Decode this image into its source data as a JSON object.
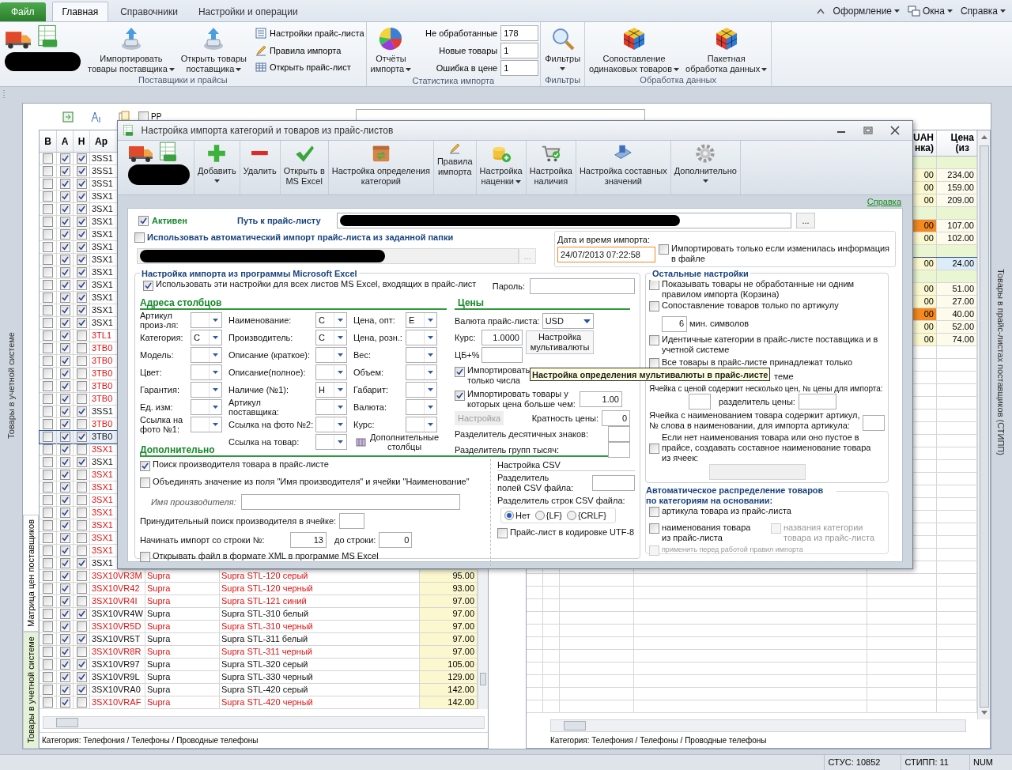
{
  "ribbon": {
    "tabs": [
      {
        "label": "Файл",
        "kind": "file",
        "selected": false
      },
      {
        "label": "Главная",
        "kind": "tab",
        "selected": true
      },
      {
        "label": "Справочники",
        "kind": "tab",
        "selected": false
      },
      {
        "label": "Настройки и операции",
        "kind": "tab",
        "selected": false
      }
    ],
    "right_menus": [
      {
        "label": "Оформление",
        "kind": "style"
      },
      {
        "label": "Окна",
        "kind": "windows"
      },
      {
        "label": "Справка",
        "kind": "plain"
      }
    ],
    "groups": [
      {
        "title": "Поставщики и прайсы",
        "buttons": [
          {
            "kind": "supplier"
          },
          {
            "kind": "import",
            "lines": [
              "Импортировать",
              "товары поставщика"
            ],
            "dropdown": true
          },
          {
            "kind": "open",
            "lines": [
              "Открыть товары",
              "поставщика"
            ],
            "dropdown": true
          }
        ],
        "small": [
          {
            "kind": "settings",
            "label": "Настройки прайс-листа"
          },
          {
            "kind": "rules",
            "label": "Правила импорта"
          },
          {
            "kind": "table",
            "label": "Открыть прайс-лист"
          }
        ]
      },
      {
        "title": "Статистика импорта",
        "buttons": [
          {
            "kind": "reports",
            "lines": [
              "Отчёты",
              "импорта"
            ],
            "dropdown": true
          }
        ],
        "stats": [
          {
            "label": "Не обработанные",
            "value": "178"
          },
          {
            "label": "Новые товары",
            "value": "1"
          },
          {
            "label": "Ошибка в цене",
            "value": "1"
          }
        ]
      },
      {
        "title": "Фильтры",
        "buttons": [
          {
            "kind": "filter",
            "lines": [
              "Фильтры"
            ],
            "dropdown": true
          }
        ]
      },
      {
        "title": "Обработка данных",
        "buttons": [
          {
            "kind": "match",
            "lines": [
              "Сопоставление",
              "одинаковых товаров"
            ],
            "dropdown": true
          },
          {
            "kind": "batch",
            "lines": [
              "Пакетная",
              "обработка данных"
            ],
            "dropdown": true
          }
        ]
      }
    ]
  },
  "background": {
    "pp": {
      "label": "PP",
      "checked": false
    },
    "left_tabs": [
      {
        "label": "Матрица цен поставщиков",
        "selected": true
      },
      {
        "label": "Товары в учетной системе",
        "selected": false
      }
    ],
    "upper_tab": "Товары в учетной системе",
    "right_tab": "Товары в прайс-листах поставщиков (СТИПП)",
    "left_table": {
      "columns": [
        "В",
        "А",
        "Н",
        "Ар"
      ],
      "rows": [
        {
          "article": "3SS1",
          "col_b": false,
          "col_a": true,
          "col_h": true,
          "highlighted": false,
          "selected": false
        },
        {
          "article": "3SS1",
          "col_b": false,
          "col_a": true,
          "col_h": true,
          "highlighted": false,
          "selected": false
        },
        {
          "article": "3SS1",
          "col_b": false,
          "col_a": true,
          "col_h": true,
          "highlighted": false,
          "selected": false
        },
        {
          "article": "3SX1",
          "col_b": false,
          "col_a": true,
          "col_h": true,
          "highlighted": false,
          "selected": false
        },
        {
          "article": "3SX1",
          "col_b": false,
          "col_a": true,
          "col_h": true,
          "highlighted": false,
          "selected": false
        },
        {
          "article": "3SX1",
          "col_b": false,
          "col_a": true,
          "col_h": true,
          "highlighted": false,
          "selected": false
        },
        {
          "article": "3SX1",
          "col_b": false,
          "col_a": true,
          "col_h": true,
          "highlighted": false,
          "selected": false
        },
        {
          "article": "3SX1",
          "col_b": false,
          "col_a": true,
          "col_h": true,
          "highlighted": false,
          "selected": false
        },
        {
          "article": "3SX1",
          "col_b": false,
          "col_a": true,
          "col_h": true,
          "highlighted": false,
          "selected": false
        },
        {
          "article": "3SX1",
          "col_b": false,
          "col_a": true,
          "col_h": true,
          "highlighted": false,
          "selected": false
        },
        {
          "article": "3SX1",
          "col_b": false,
          "col_a": true,
          "col_h": true,
          "highlighted": false,
          "selected": false
        },
        {
          "article": "3SX1",
          "col_b": false,
          "col_a": true,
          "col_h": true,
          "highlighted": false,
          "selected": false
        },
        {
          "article": "3SX1",
          "col_b": false,
          "col_a": true,
          "col_h": true,
          "highlighted": false,
          "selected": false
        },
        {
          "article": "3SX1",
          "col_b": false,
          "col_a": true,
          "col_h": true,
          "highlighted": false,
          "selected": false
        },
        {
          "article": "3TL1",
          "col_b": false,
          "col_a": true,
          "col_h": false,
          "highlighted": true,
          "selected": false
        },
        {
          "article": "3TB0",
          "col_b": false,
          "col_a": true,
          "col_h": false,
          "highlighted": true,
          "selected": false
        },
        {
          "article": "3TB0",
          "col_b": false,
          "col_a": true,
          "col_h": false,
          "highlighted": true,
          "selected": false
        },
        {
          "article": "3TB0",
          "col_b": false,
          "col_a": true,
          "col_h": false,
          "highlighted": true,
          "selected": false
        },
        {
          "article": "3TB0",
          "col_b": false,
          "col_a": true,
          "col_h": false,
          "highlighted": true,
          "selected": false
        },
        {
          "article": "3TB0",
          "col_b": false,
          "col_a": true,
          "col_h": false,
          "highlighted": true,
          "selected": false
        },
        {
          "article": "3SS1",
          "col_b": false,
          "col_a": true,
          "col_h": true,
          "highlighted": false,
          "selected": false
        },
        {
          "article": "3TB0",
          "col_b": false,
          "col_a": true,
          "col_h": false,
          "highlighted": true,
          "selected": false
        },
        {
          "article": "3TB0",
          "col_b": false,
          "col_a": true,
          "col_h": true,
          "highlighted": false,
          "selected": true
        },
        {
          "article": "3SX1",
          "col_b": false,
          "col_a": true,
          "col_h": false,
          "highlighted": true,
          "selected": false
        },
        {
          "article": "3SX1",
          "col_b": false,
          "col_a": true,
          "col_h": true,
          "highlighted": false,
          "selected": false
        },
        {
          "article": "3SX1",
          "col_b": false,
          "col_a": true,
          "col_h": false,
          "highlighted": true,
          "selected": false
        },
        {
          "article": "3SX1",
          "col_b": false,
          "col_a": true,
          "col_h": false,
          "highlighted": true,
          "selected": false
        },
        {
          "article": "3SX1",
          "col_b": false,
          "col_a": true,
          "col_h": false,
          "highlighted": true,
          "selected": false
        },
        {
          "article": "3SX1",
          "col_b": false,
          "col_a": true,
          "col_h": false,
          "highlighted": true,
          "selected": false
        },
        {
          "article": "3SX1",
          "col_b": false,
          "col_a": true,
          "col_h": false,
          "highlighted": true,
          "selected": false
        },
        {
          "article": "3SX1",
          "col_b": false,
          "col_a": true,
          "col_h": false,
          "highlighted": true,
          "selected": false
        },
        {
          "article": "3SX1",
          "col_b": false,
          "col_a": true,
          "col_h": false,
          "highlighted": true,
          "selected": false
        },
        {
          "article": "3SX1",
          "col_b": false,
          "col_a": true,
          "col_h": true,
          "highlighted": false,
          "selected": false
        },
        {
          "article": "3SX10VR3M",
          "brand": "Supra",
          "name": "Supra STL-120 серый",
          "price": "95.00",
          "col_b": false,
          "col_a": true,
          "col_h": false,
          "highlighted": true,
          "selected": false
        },
        {
          "article": "3SX10VR42",
          "brand": "Supra",
          "name": "Supra STL-120 черный",
          "price": "93.00",
          "col_b": false,
          "col_a": true,
          "col_h": false,
          "highlighted": true,
          "selected": false
        },
        {
          "article": "3SX10VR4I",
          "brand": "Supra",
          "name": "Supra STL-121 синий",
          "price": "97.00",
          "col_b": false,
          "col_a": true,
          "col_h": false,
          "highlighted": true,
          "selected": false
        },
        {
          "article": "3SX10VR4W",
          "brand": "Supra",
          "name": "Supra STL-310 белый",
          "price": "97.00",
          "col_b": false,
          "col_a": true,
          "col_h": true,
          "highlighted": false,
          "selected": false
        },
        {
          "article": "3SX10VR5D",
          "brand": "Supra",
          "name": "Supra STL-310 черный",
          "price": "97.00",
          "col_b": false,
          "col_a": true,
          "col_h": false,
          "highlighted": true,
          "selected": false
        },
        {
          "article": "3SX10VR5T",
          "brand": "Supra",
          "name": "Supra STL-311 белый",
          "price": "97.00",
          "col_b": false,
          "col_a": true,
          "col_h": true,
          "highlighted": false,
          "selected": false
        },
        {
          "article": "3SX10VR8R",
          "brand": "Supra",
          "name": "Supra STL-311 черный",
          "price": "97.00",
          "col_b": false,
          "col_a": true,
          "col_h": false,
          "highlighted": true,
          "selected": false
        },
        {
          "article": "3SX10VR97",
          "brand": "Supra",
          "name": "Supra STL-320 серый",
          "price": "105.00",
          "col_b": false,
          "col_a": true,
          "col_h": true,
          "highlighted": false,
          "selected": false
        },
        {
          "article": "3SX10VR9L",
          "brand": "Supra",
          "name": "Supra STL-330 черный",
          "price": "129.00",
          "col_b": false,
          "col_a": true,
          "col_h": true,
          "highlighted": false,
          "selected": false
        },
        {
          "article": "3SX10VRA0",
          "brand": "Supra",
          "name": "Supra STL-420 серый",
          "price": "142.00",
          "col_b": false,
          "col_a": true,
          "col_h": true,
          "highlighted": false,
          "selected": false
        },
        {
          "article": "3SX10VRAF",
          "brand": "Supra",
          "name": "Supra STL-420 черный",
          "price": "142.00",
          "col_b": false,
          "col_a": true,
          "col_h": false,
          "highlighted": true,
          "selected": false
        }
      ]
    },
    "left_footer": "Категория: Телефония / Телефоны / Проводные телефоны",
    "right_table": {
      "columns": [
        "UAH\nнка)",
        "Цена\n(из"
      ],
      "rows": [
        {
          "kind": "group"
        },
        {
          "kind": "item",
          "uah": "00",
          "price": "234.00",
          "warning": false,
          "selected": false
        },
        {
          "kind": "item",
          "uah": "00",
          "price": "159.00",
          "warning": false,
          "selected": false
        },
        {
          "kind": "item",
          "uah": "00",
          "price": "209.00",
          "warning": false,
          "selected": false
        },
        {
          "kind": "group"
        },
        {
          "kind": "item",
          "uah": "00",
          "price": "107.00",
          "warning": true,
          "selected": false
        },
        {
          "kind": "item",
          "uah": "00",
          "price": "102.00",
          "warning": false,
          "selected": false
        },
        {
          "kind": "group"
        },
        {
          "kind": "item",
          "uah": "00",
          "price": "24.00",
          "warning": false,
          "selected": true
        },
        {
          "kind": "group"
        },
        {
          "kind": "item",
          "uah": "00",
          "price": "51.00",
          "warning": false,
          "selected": false
        },
        {
          "kind": "item",
          "uah": "00",
          "price": "27.00",
          "warning": false,
          "selected": false
        },
        {
          "kind": "item",
          "uah": "00",
          "price": "40.00",
          "warning": true,
          "selected": false
        },
        {
          "kind": "item",
          "uah": "00",
          "price": "52.00",
          "warning": false,
          "selected": false
        },
        {
          "kind": "item",
          "uah": "00",
          "price": "74.00",
          "warning": false,
          "selected": false
        }
      ]
    },
    "right_footer": "Категория: Телефония / Телефоны / Проводные телефоны"
  },
  "dialog": {
    "title": "Настройка импорта категорий и товаров из прайс-листов",
    "toolbar": [
      {
        "kind": "supplier"
      },
      {
        "kind": "add",
        "lines": [
          "Добавить"
        ],
        "dropdown": true
      },
      {
        "kind": "delete",
        "lines": [
          "Удалить"
        ],
        "dropdown": false
      },
      {
        "kind": "excel",
        "lines": [
          "Открыть в",
          "MS Excel"
        ],
        "dropdown": false
      },
      {
        "kind": "categories",
        "lines": [
          "Настройка определения",
          "категорий"
        ],
        "dropdown": false
      },
      {
        "kind": "rules",
        "lines": [
          "Правила",
          "импорта"
        ],
        "dropdown": false
      },
      {
        "kind": "markup",
        "lines": [
          "Настройка",
          "наценки"
        ],
        "dropdown": true
      },
      {
        "kind": "stock",
        "lines": [
          "Настройка",
          "наличия"
        ],
        "dropdown": false
      },
      {
        "kind": "composite",
        "lines": [
          "Настройка составных",
          "значений"
        ],
        "dropdown": false
      },
      {
        "kind": "more",
        "lines": [
          "Дополнительно"
        ],
        "dropdown": true
      }
    ],
    "help_link": "Справка",
    "active": {
      "label": "Активен",
      "checked": true
    },
    "path_label": "Путь к прайс-листу",
    "browse": "...",
    "auto_import": {
      "label": "Использовать автоматический импорт прайс-листа из заданной папки",
      "checked": false,
      "browse": "...",
      "date_label": "Дата и время импорта:",
      "date_value": "24/07/2013 07:22:58",
      "only_changed": {
        "label": "Импортировать только если изменилась информация в файле",
        "checked": false
      }
    },
    "excel": {
      "legend": "Настройка импорта из программы Microsoft Excel",
      "all_sheets": {
        "label": "Использовать эти настройки для всех листов MS Excel, входящих в прайс-лист",
        "checked": true
      },
      "password_label": "Пароль:",
      "columns_heading": "Адреса столбцов",
      "columns": [
        [
          {
            "label": "Артикул\nпроиз-ля:"
          },
          {
            "label": "Категория:",
            "value": "C"
          },
          {
            "label": "Модель:"
          },
          {
            "label": "Цвет:"
          },
          {
            "label": "Гарантия:"
          },
          {
            "label": "Ед. изм:"
          },
          {
            "label": "Ссылка на\nфото №1:"
          }
        ],
        [
          {
            "label": "Наименование:",
            "value": "C"
          },
          {
            "label": "Производитель:",
            "value": "C"
          },
          {
            "label": "Описание (краткое):"
          },
          {
            "label": "Описание(полное):"
          },
          {
            "label": "Наличие (№1):",
            "value": "H"
          },
          {
            "label": "Артикул\nпоставщика:"
          },
          {
            "label": "Ссылка на фото №2:"
          },
          {
            "label": "Ссылка на товар:"
          }
        ],
        [
          {
            "label": "Цена, опт:",
            "value": "E"
          },
          {
            "label": "Цена, розн.:"
          },
          {
            "label": "Вес:"
          },
          {
            "label": "Объем:"
          },
          {
            "label": "Габарит:"
          },
          {
            "label": "Валюта:"
          },
          {
            "label": "Курс:"
          }
        ]
      ],
      "extra_columns": "Дополнительные\nстолбцы",
      "prices": {
        "heading": "Цены",
        "currency_label": "Валюта прайс-листа:",
        "currency": "USD",
        "rate_label": "Курс:",
        "rate": "1.0000",
        "multicurrency_button": "Настройка мультивалюты",
        "cb_label": "ЦБ+%",
        "numbers_only": {
          "label": "Импортировать только числа",
          "checked": true
        },
        "min_price": {
          "label": "Импортировать товары у которых цена больше чем:",
          "checked": true,
          "value": "1.00"
        },
        "settings_button": {
          "label": "Настройка",
          "disabled": true
        },
        "multiplicity_label": "Кратность цены:",
        "multiplicity": "0",
        "decimal_label": "Разделитель десятичных знаков:",
        "thousands_label": "Разделитель групп тысяч:"
      },
      "extra": {
        "heading": "Дополнительно",
        "search_maker": {
          "label": "Поиск производителя товара в прайс-листе",
          "checked": true
        },
        "merge": {
          "label": "Объединять значение из поля \"Имя производителя\" и ячейки \"Наименование\"",
          "checked": false
        },
        "maker_name_label": "Имя производителя:",
        "forced_label": "Принудительный поиск производителя в ячейке:",
        "start_label": "Начинать импорт со строки №:",
        "start": "13",
        "end_label": "до строки:",
        "end": "0",
        "xml": {
          "label": "Открывать файл в формате XML в программе MS Excel",
          "checked": false
        }
      },
      "csv": {
        "heading": "Настройка CSV",
        "field_sep_label": "Разделитель\nполей CSV файла:",
        "row_sep_label": "Разделитель строк CSV файла:",
        "row_seps": [
          {
            "label": "Нет",
            "selected": true
          },
          {
            "label": "{LF}",
            "selected": false
          },
          {
            "label": "{CRLF}",
            "selected": false
          }
        ],
        "utf8": {
          "label": "Прайс-лист в кодировке UTF-8",
          "checked": false
        }
      }
    },
    "tooltip": "Настройка определения мультивалюты в прайс-листе",
    "other": {
      "legend": "Остальные настройки",
      "show_unprocessed": {
        "label": "Показывать товары не обработанные ни одним правилом импорта (Корзина)",
        "checked": false
      },
      "match_by_article": {
        "label": "Сопоставление товаров только по артикулу",
        "checked": false
      },
      "min_chars": "6",
      "min_chars_label": "мин. символов",
      "identical": {
        "label": "Идентичные категории в прайс-листе поставщика и в учетной системе",
        "checked": false
      },
      "all_goods": {
        "label": "Все товары в прайс-листе принадлежат только",
        "checked": false
      },
      "all_goods_tail": "теме",
      "multi_price": "Ячейка с ценой содержит несколько цен, № цены для импорта:",
      "price_sep_label": "разделитель цены:",
      "article_in_name": "Ячейка с наименованием товара содержит артикул, № слова в наименовании, для импорта артикула:",
      "composite": {
        "label": "Если нет наименования товара или оно пустое в прайсе, создавать составное наименование товара из ячеек:",
        "checked": false
      }
    },
    "auto_dist": {
      "legend": "Автоматическое распределение товаров по категориям на основании:",
      "options": [
        {
          "label": "артикула товара из прайс-листа",
          "checked": false,
          "disabled": false,
          "kind": "full"
        },
        {
          "label": "наименования товара из прайс-листа",
          "checked": false,
          "disabled": false,
          "kind": "half"
        },
        {
          "label": "названия  категории товара из прайс-листа",
          "checked": false,
          "disabled": true,
          "kind": "half"
        },
        {
          "label": "применить перед работой правил импорта",
          "checked": false,
          "disabled": true,
          "kind": "small"
        }
      ]
    }
  },
  "status_bar": [
    "СТУС: 10852",
    "СТИПП: 11",
    "NUM"
  ]
}
